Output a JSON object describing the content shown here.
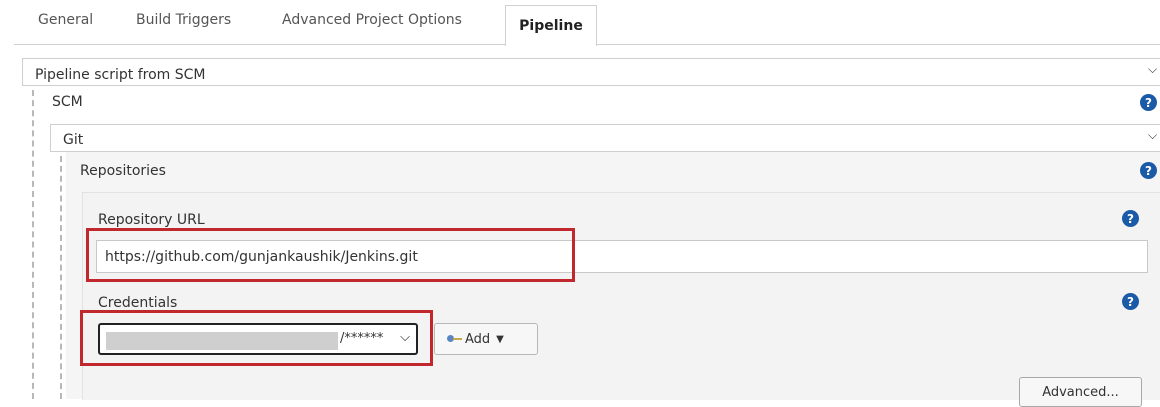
{
  "tabs": [
    {
      "label": "General"
    },
    {
      "label": "Build Triggers"
    },
    {
      "label": "Advanced Project Options"
    },
    {
      "label": "Pipeline"
    }
  ],
  "definition": {
    "selected": "Pipeline script from SCM"
  },
  "scm": {
    "label": "SCM",
    "selected": "Git"
  },
  "repositories": {
    "label": "Repositories"
  },
  "repository_url": {
    "label": "Repository URL",
    "value": "https://github.com/gunjankaushik/Jenkins.git"
  },
  "credentials": {
    "label": "Credentials",
    "visible_suffix": "/******",
    "add_label": "Add"
  },
  "advanced_label": "Advanced...",
  "icons": {
    "help": "help-question-icon",
    "chevron": "chevron-down-icon",
    "key": "key-icon",
    "caret": "caret-down-icon"
  },
  "colors": {
    "highlight_box": "#c0282d",
    "help_icon": "#1a5aa6"
  }
}
